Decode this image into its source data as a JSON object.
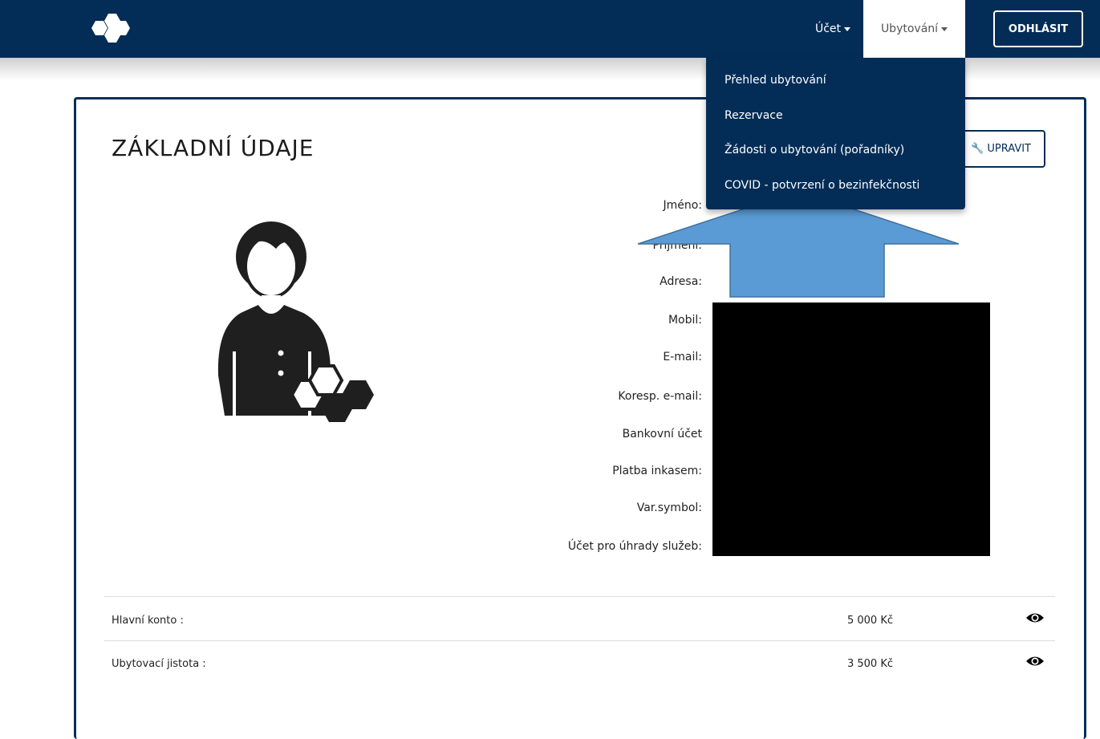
{
  "topbar": {
    "nav": [
      {
        "label": "Účet"
      },
      {
        "label": "Ubytování"
      }
    ],
    "logout_label": "ODHLÁSIT"
  },
  "dropdown": {
    "items": [
      {
        "label": "Přehled ubytování"
      },
      {
        "label": "Rezervace"
      },
      {
        "label": "Žádosti o ubytování (pořadníky)"
      },
      {
        "label": "COVID - potvrzení o bezinfekčnosti"
      }
    ]
  },
  "card": {
    "title": "ZÁKLADNÍ ÚDAJE",
    "edit_label": "UPRAVIT"
  },
  "fields": [
    {
      "label": "Jméno:"
    },
    {
      "label": "Příjmení:"
    },
    {
      "label": "Adresa:"
    },
    {
      "label": "Mobil:"
    },
    {
      "label": "E-mail:"
    },
    {
      "label": "Koresp. e-mail:"
    },
    {
      "label": "Bankovní účet"
    },
    {
      "label": "Platba inkasem:"
    },
    {
      "label": "Var.symbol:"
    },
    {
      "label": "Účet pro úhrady služeb:"
    }
  ],
  "accounts": [
    {
      "label": "Hlavní konto :",
      "value": "5 000 Kč"
    },
    {
      "label": "Ubytovací jistota :",
      "value": "3 500 Kč"
    }
  ],
  "colors": {
    "navy": "#032d57",
    "arrow_fill": "#5b9bd5",
    "arrow_stroke": "#41719c"
  },
  "icons": {
    "logo": "hexagon-cluster-logo",
    "avatar": "user-avatar-illustration",
    "edit": "wrench-icon",
    "view": "eye-icon"
  }
}
